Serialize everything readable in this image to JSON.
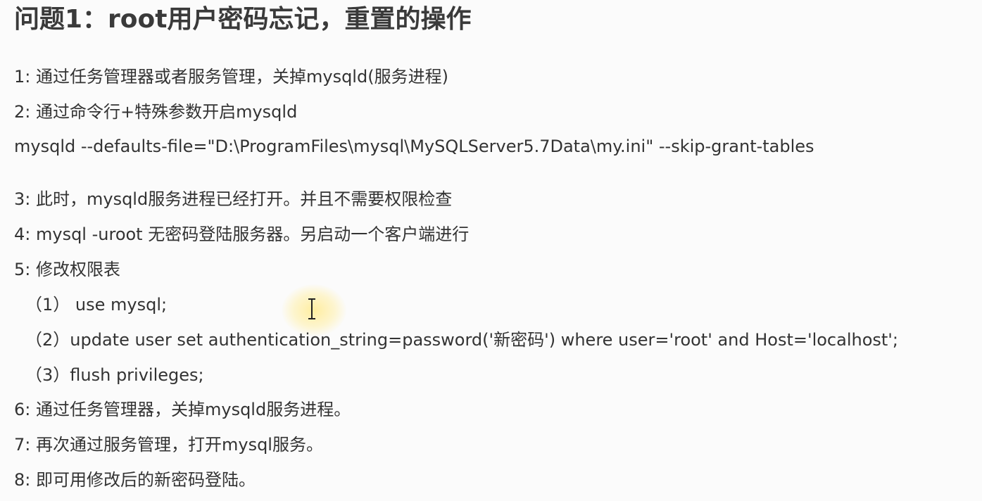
{
  "doc": {
    "title": "问题1：root用户密码忘记，重置的操作",
    "lines": [
      "1: 通过任务管理器或者服务管理，关掉mysqld(服务进程)",
      "2: 通过命令行+特殊参数开启mysqld",
      "mysqld --defaults-file=\"D:\\ProgramFiles\\mysql\\MySQLServer5.7Data\\my.ini\" --skip-grant-tables",
      "3: 此时，mysqld服务进程已经打开。并且不需要权限检查",
      "4: mysql -uroot 无密码登陆服务器。另启动一个客户端进行",
      "5: 修改权限表",
      "（1） use mysql;",
      "（2）update user set authentication_string=password('新密码') where user='root' and Host='localhost';",
      "（3）flush privileges;",
      "6: 通过任务管理器，关掉mysqld服务进程。",
      "7: 再次通过服务管理，打开mysql服务。",
      "8: 即可用修改后的新密码登陆。"
    ]
  },
  "cursor": {
    "icon": "text-cursor-icon",
    "highlight_color": "#ffe98c"
  }
}
